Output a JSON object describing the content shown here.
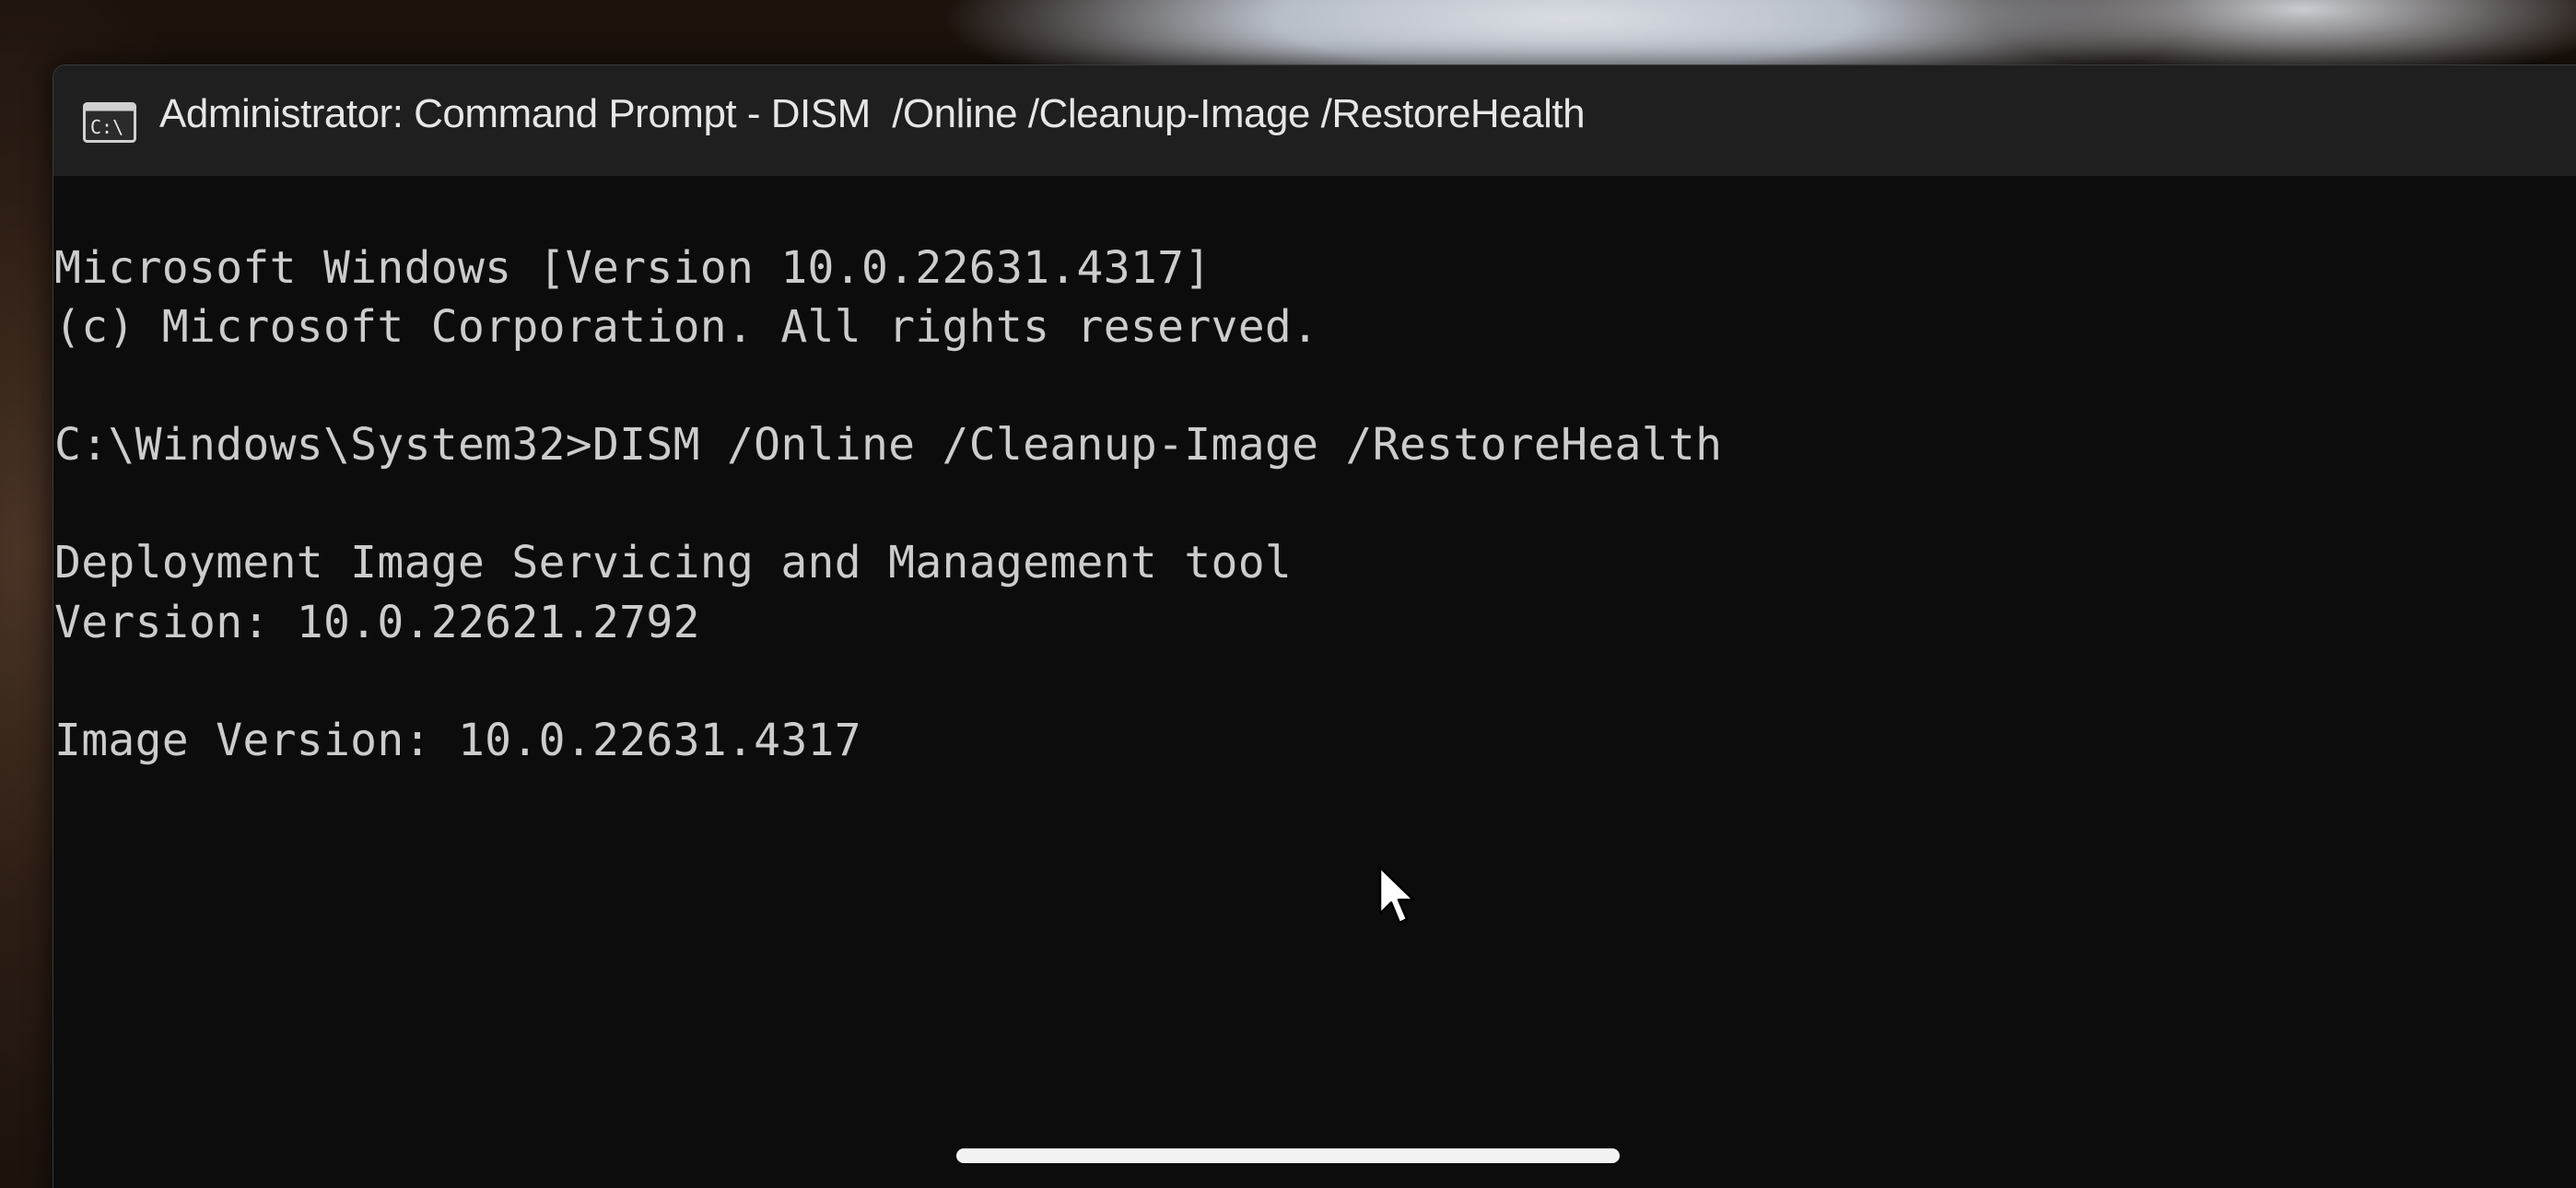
{
  "window": {
    "title": "Administrator: Command Prompt - DISM  /Online /Cleanup-Image /RestoreHealth",
    "icon": "cmd-icon"
  },
  "console": {
    "lines": [
      "Microsoft Windows [Version 10.0.22631.4317]",
      "(c) Microsoft Corporation. All rights reserved.",
      "C:\\Windows\\System32>DISM /Online /Cleanup-Image /RestoreHealth",
      "Deployment Image Servicing and Management tool",
      "Version: 10.0.22621.2792",
      "Image Version: 10.0.22631.4317"
    ]
  },
  "colors": {
    "console_background": "#0c0c0c",
    "console_text": "#cccccc",
    "titlebar_background": "#1f1f1f",
    "title_text": "#e6e6e6"
  }
}
